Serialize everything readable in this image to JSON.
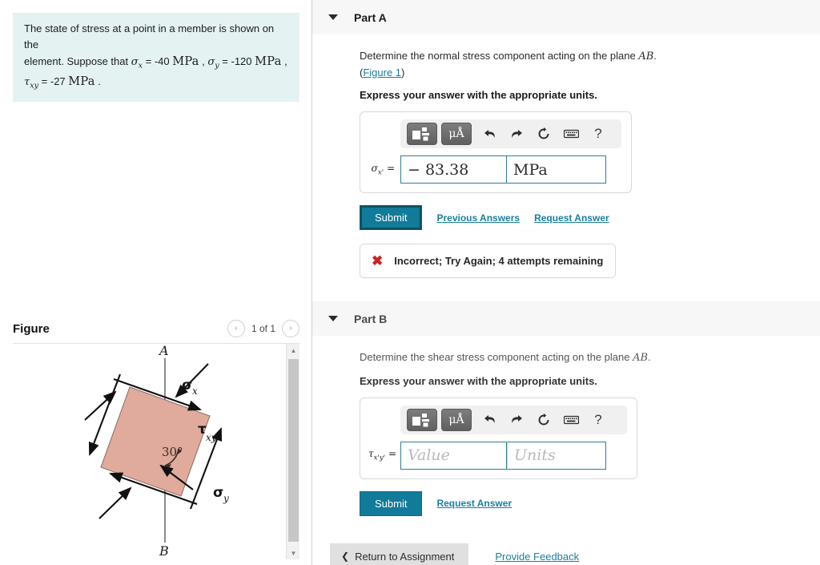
{
  "problem": {
    "line1_a": "The state of stress at a point in a member is shown on the",
    "line1_b": "element. Suppose that ",
    "sigma_x_sym": "σ",
    "sigma_x_sub": "x",
    "sigma_x_eq": " = -40 ",
    "unit_mpa": "MPa",
    "comma1": " , ",
    "sigma_y_sym": "σ",
    "sigma_y_sub": "y",
    "sigma_y_eq": " = -120 ",
    "comma2": " ,",
    "tau_sym": "τ",
    "tau_sub": "xy",
    "tau_eq": " = -27 ",
    "period": " ."
  },
  "figure": {
    "title": "Figure",
    "pager_prev": "‹",
    "pager_next": "›",
    "count": "1 of 1",
    "labels": {
      "A": "A",
      "B": "B",
      "sigma_x": "σ",
      "sigma_x_sub": "x",
      "sigma_y": "σ",
      "sigma_y_sub": "y",
      "tau": "τ",
      "tau_sub": "xy",
      "angle": "30°"
    },
    "element_fill": "#e0aa9c",
    "scroll_up": "▲",
    "scroll_down": "▼"
  },
  "part_a": {
    "label": "Part A",
    "question_pre": "Determine the normal stress component acting on the plane ",
    "question_plane": "AB",
    "question_post": ".",
    "figure_link_open": "(",
    "figure_link": "Figure 1",
    "figure_link_close": ")",
    "express": "Express your answer with the appropriate units.",
    "answer_symbol": "σ",
    "answer_subscript": "x'",
    "answer_equals": " =",
    "value": "− 83.38",
    "units": "MPa",
    "submit_label": "Submit",
    "previous_answers_label": "Previous Answers",
    "request_answer_label": "Request Answer",
    "feedback_icon": "✖",
    "feedback_text": "Incorrect; Try Again; 4 attempts remaining"
  },
  "part_b": {
    "label": "Part B",
    "question_pre": "Determine the shear stress component acting on the plane ",
    "question_plane": "AB",
    "question_post": ".",
    "express": "Express your answer with the appropriate units.",
    "answer_symbol": "τ",
    "answer_subscript": "x'y'",
    "answer_equals": " =",
    "value_placeholder": "Value",
    "units_placeholder": "Units",
    "submit_label": "Submit",
    "request_answer_label": "Request Answer"
  },
  "toolbar": {
    "template_icon": "template-icon",
    "units_icon_label": "μÅ",
    "undo_icon": "undo-icon",
    "redo_icon": "redo-icon",
    "reset_icon": "reset-icon",
    "keyboard_icon": "keyboard-icon",
    "help_label": "?"
  },
  "footer": {
    "return_chevron": "❮",
    "return_label": "Return to Assignment",
    "feedback_label": "Provide Feedback"
  },
  "colors": {
    "accent_teal": "#127b9a",
    "link": "#1a7fa0",
    "problem_bg": "#e4f2f2",
    "error_red": "#cc2222"
  }
}
